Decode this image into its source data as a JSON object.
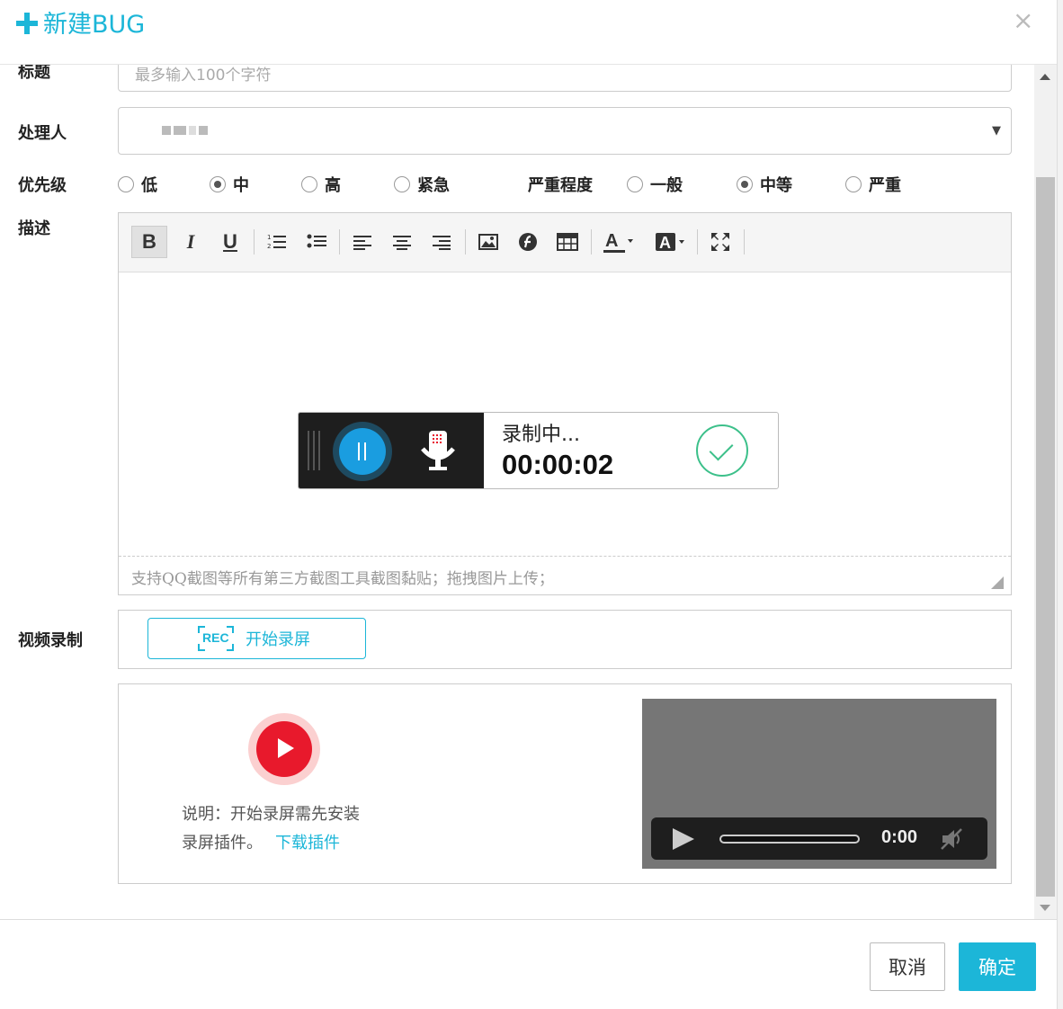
{
  "dialog": {
    "title": "新建BUG",
    "close_glyph": "×"
  },
  "form": {
    "title_label": "标题",
    "title_placeholder": "最多输入100个字符",
    "assignee_label": "处理人",
    "priority_label": "优先级",
    "priority_options": [
      {
        "label": "低",
        "checked": false
      },
      {
        "label": "中",
        "checked": true
      },
      {
        "label": "高",
        "checked": false
      },
      {
        "label": "紧急",
        "checked": false
      }
    ],
    "severity_label": "严重程度",
    "severity_options": [
      {
        "label": "一般",
        "checked": false
      },
      {
        "label": "中等",
        "checked": true
      },
      {
        "label": "严重",
        "checked": false
      }
    ],
    "description_label": "描述",
    "editor_hint": "支持QQ截图等所有第三方截图工具截图黏贴；拖拽图片上传；",
    "video_label": "视频录制"
  },
  "toolbar": {
    "bold": "B",
    "italic": "I",
    "underline": "U"
  },
  "recorder": {
    "status": "录制中...",
    "time": "00:00:02"
  },
  "video_record": {
    "rec_badge": "REC",
    "start_label": "开始录屏"
  },
  "plugin": {
    "note_line1": "说明：开始录屏需先安装",
    "note_line2": "录屏插件。",
    "download_link": "下载插件"
  },
  "player": {
    "time": "0:00"
  },
  "footer": {
    "cancel_label": "取消",
    "ok_label": "确定"
  },
  "colors": {
    "accent": "#1cb6d8",
    "record_red": "#e8192c",
    "confirm_green": "#3cc08a"
  }
}
